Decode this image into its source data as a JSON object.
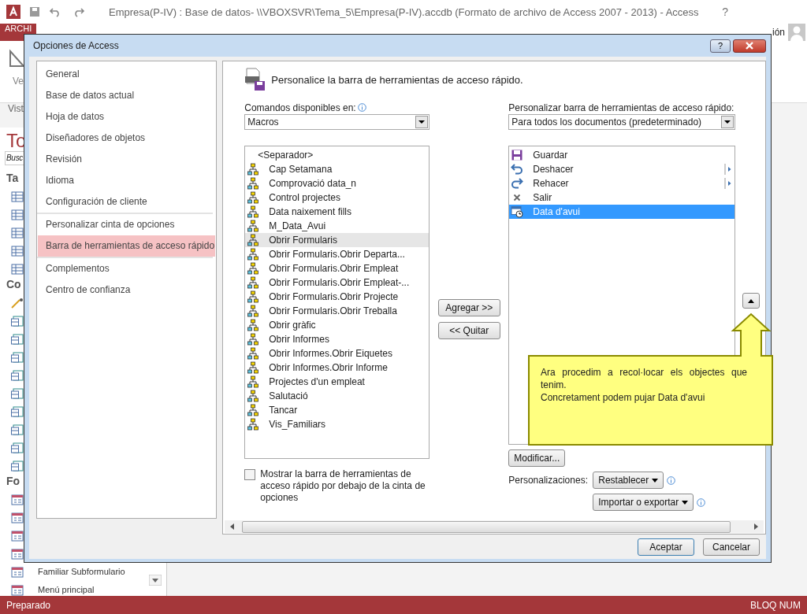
{
  "app": {
    "title": "Empresa(P-IV) : Base de datos- \\\\VBOXSVR\\Tema_5\\Empresa(P-IV).accdb (Formato de archivo de Access 2007 - 2013) - Access",
    "help": "?",
    "file_tab": "ARCHI",
    "signin": "ión",
    "ribbon_label": "Ve",
    "group_label": "Vist",
    "nav": [
      {
        "kind": "title",
        "label": "To"
      },
      {
        "kind": "search",
        "label": "Busc"
      },
      {
        "kind": "header",
        "label": "Ta"
      },
      {
        "kind": "table"
      },
      {
        "kind": "table"
      },
      {
        "kind": "table"
      },
      {
        "kind": "table"
      },
      {
        "kind": "table"
      },
      {
        "kind": "header",
        "label": "Co"
      },
      {
        "kind": "wand"
      },
      {
        "kind": "query"
      },
      {
        "kind": "query"
      },
      {
        "kind": "query"
      },
      {
        "kind": "query"
      },
      {
        "kind": "query"
      },
      {
        "kind": "query"
      },
      {
        "kind": "query"
      },
      {
        "kind": "query"
      },
      {
        "kind": "query"
      },
      {
        "kind": "header",
        "label": "Fo"
      },
      {
        "kind": "form"
      },
      {
        "kind": "form"
      },
      {
        "kind": "form"
      },
      {
        "kind": "form"
      },
      {
        "kind": "form",
        "label": "Familiar Subformulario"
      },
      {
        "kind": "form",
        "label": "Menú principal"
      }
    ],
    "status_bar": {
      "left": "Preparado",
      "right": "BLOQ NUM"
    }
  },
  "dialog": {
    "title": "Opciones de Access",
    "help": "?",
    "category_groups": [
      [
        {
          "label": "General",
          "selected": false
        },
        {
          "label": "Base de datos actual",
          "selected": false
        },
        {
          "label": "Hoja de datos",
          "selected": false
        },
        {
          "label": "Diseñadores de objetos",
          "selected": false
        },
        {
          "label": "Revisión",
          "selected": false
        },
        {
          "label": "Idioma",
          "selected": false
        },
        {
          "label": "Configuración de cliente",
          "selected": false
        }
      ],
      [
        {
          "label": "Personalizar cinta de opciones",
          "selected": false
        },
        {
          "label": "Barra de herramientas de acceso rápido",
          "selected": true
        }
      ],
      [
        {
          "label": "Complementos",
          "selected": false
        },
        {
          "label": "Centro de confianza",
          "selected": false
        }
      ]
    ],
    "heading": "Personalice la barra de herramientas de acceso rápido.",
    "commands_label": "Comandos disponibles en:",
    "commands_combo": "Macros",
    "commands": [
      {
        "kind": "separator",
        "label": "<Separador>",
        "selected": false
      },
      {
        "kind": "macro",
        "label": "Cap Setamana",
        "selected": false
      },
      {
        "kind": "macro",
        "label": "Comprovació data_n",
        "selected": false
      },
      {
        "kind": "macro",
        "label": "Control projectes",
        "selected": false
      },
      {
        "kind": "macro",
        "label": "Data naixement fills",
        "selected": false
      },
      {
        "kind": "macro",
        "label": "M_Data_Avui",
        "selected": false
      },
      {
        "kind": "macro",
        "label": "Obrir Formularis",
        "selected": true
      },
      {
        "kind": "macro",
        "label": "Obrir Formularis.Obrir Departa...",
        "selected": false
      },
      {
        "kind": "macro",
        "label": "Obrir Formularis.Obrir Empleat",
        "selected": false
      },
      {
        "kind": "macro",
        "label": "Obrir Formularis.Obrir Empleat-...",
        "selected": false
      },
      {
        "kind": "macro",
        "label": "Obrir Formularis.Obrir Projecte",
        "selected": false
      },
      {
        "kind": "macro",
        "label": "Obrir Formularis.Obrir Treballa",
        "selected": false
      },
      {
        "kind": "macro",
        "label": "Obrir gràfic",
        "selected": false
      },
      {
        "kind": "macro",
        "label": "Obrir Informes",
        "selected": false
      },
      {
        "kind": "macro",
        "label": "Obrir Informes.Obrir Eiquetes",
        "selected": false
      },
      {
        "kind": "macro",
        "label": "Obrir Informes.Obrir Informe",
        "selected": false
      },
      {
        "kind": "macro",
        "label": "Projectes d'un empleat",
        "selected": false
      },
      {
        "kind": "macro",
        "label": "Salutació",
        "selected": false
      },
      {
        "kind": "macro",
        "label": "Tancar",
        "selected": false
      },
      {
        "kind": "macro",
        "label": "Vis_Familiars",
        "selected": false
      }
    ],
    "add_button": "Agregar >>",
    "remove_button": "<< Quitar",
    "toolbar_label": "Personalizar barra de herramientas de acceso rápido:",
    "toolbar_combo": "Para todos los documentos (predeterminado)",
    "toolbar_items": [
      {
        "kind": "save",
        "label": "Guardar",
        "submenu": false,
        "selected": false
      },
      {
        "kind": "undo",
        "label": "Deshacer",
        "submenu": true,
        "selected": false
      },
      {
        "kind": "redo",
        "label": "Rehacer",
        "submenu": true,
        "selected": false
      },
      {
        "kind": "exit",
        "label": "Salir",
        "submenu": false,
        "selected": false
      },
      {
        "kind": "date",
        "label": "Data d'avui",
        "submenu": false,
        "selected": true
      }
    ],
    "show_below": {
      "label": "Mostrar la barra de herramientas de acceso rápido por debajo de la cinta de opciones",
      "checked": false
    },
    "modify_button": "Modificar...",
    "customizations_label": "Personalizaciones:",
    "reset_button": "Restablecer",
    "import_button": "Importar o exportar",
    "ok_button": "Aceptar",
    "cancel_button": "Cancelar"
  },
  "callout": {
    "lines": [
      "Ara procedim a recol·locar els objectes que tenim.",
      "Concretament podem pujar Data d'avui"
    ]
  }
}
